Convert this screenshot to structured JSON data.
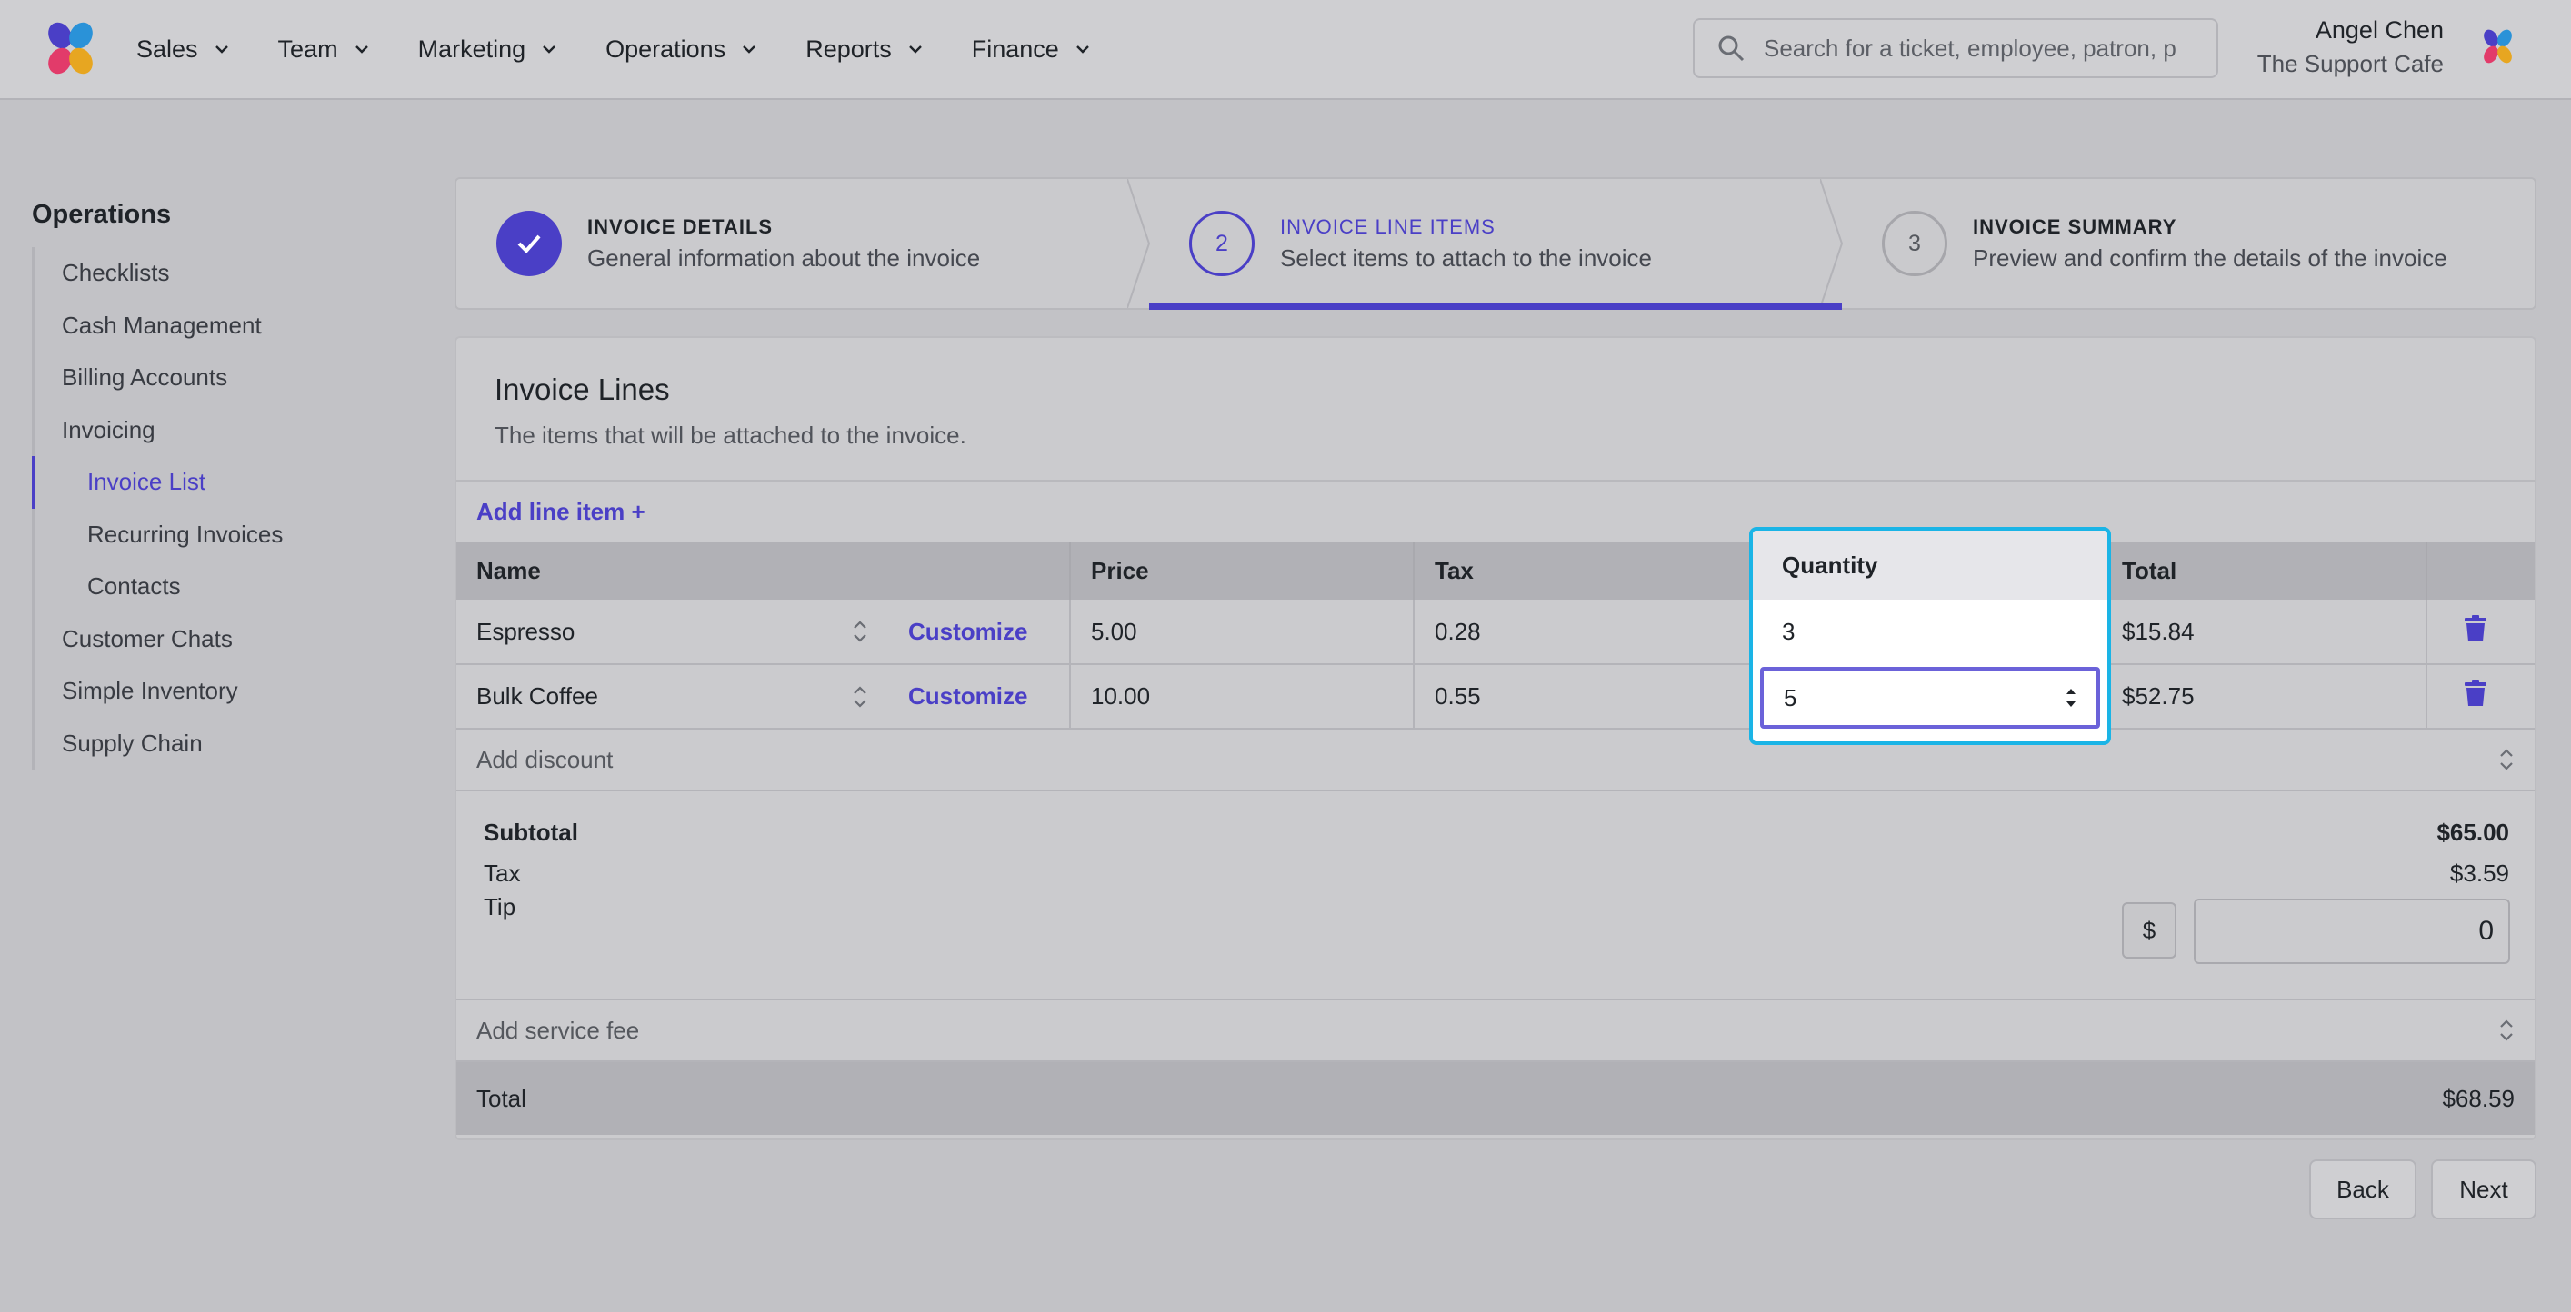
{
  "nav": {
    "items": [
      "Sales",
      "Team",
      "Marketing",
      "Operations",
      "Reports",
      "Finance"
    ],
    "search_placeholder": "Search for a ticket, employee, patron, p"
  },
  "user": {
    "name": "Angel Chen",
    "org": "The Support Cafe"
  },
  "sidebar": {
    "title": "Operations",
    "items": [
      {
        "label": "Checklists"
      },
      {
        "label": "Cash Management"
      },
      {
        "label": "Billing Accounts"
      },
      {
        "label": "Invoicing"
      },
      {
        "label": "Invoice List"
      },
      {
        "label": "Recurring Invoices"
      },
      {
        "label": "Contacts"
      },
      {
        "label": "Customer Chats"
      },
      {
        "label": "Simple Inventory"
      },
      {
        "label": "Supply Chain"
      }
    ]
  },
  "steps": [
    {
      "label": "INVOICE DETAILS",
      "desc": "General information about the invoice",
      "status": "done"
    },
    {
      "label": "INVOICE LINE ITEMS",
      "desc": "Select items to attach to the invoice",
      "number": "2",
      "status": "current"
    },
    {
      "label": "INVOICE SUMMARY",
      "desc": "Preview and confirm the details of the invoice",
      "number": "3",
      "status": "upcoming"
    }
  ],
  "card": {
    "title": "Invoice Lines",
    "subtitle": "The items that will be attached to the invoice.",
    "add_line": "Add line item +",
    "columns": [
      "Name",
      "Price",
      "Tax",
      "Quantity",
      "Total"
    ],
    "customize_label": "Customize",
    "rows": [
      {
        "name": "Espresso",
        "price": "5.00",
        "tax": "0.28",
        "quantity": "3",
        "total": "$15.84"
      },
      {
        "name": "Bulk Coffee",
        "price": "10.00",
        "tax": "0.55",
        "quantity": "5",
        "total": "$52.75"
      }
    ],
    "add_discount": "Add discount",
    "subtotal_label": "Subtotal",
    "subtotal_value": "$65.00",
    "tax_label": "Tax",
    "tax_value": "$3.59",
    "tip_label": "Tip",
    "tip_currency": "$",
    "tip_value": "0",
    "add_service_fee": "Add service fee",
    "total_label": "Total",
    "total_value": "$68.59"
  },
  "buttons": {
    "back": "Back",
    "next": "Next"
  },
  "colors": {
    "accent": "#4a3fc6",
    "highlight": "#1ab4e6"
  }
}
